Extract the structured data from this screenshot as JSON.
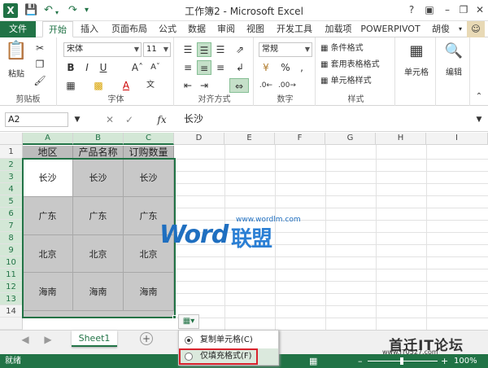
{
  "window": {
    "title": "工作簿2 - Microsoft Excel",
    "help": "?",
    "user": "胡俊",
    "app_icon": "X"
  },
  "ribbon_tabs": [
    "文件",
    "开始",
    "插入",
    "页面布局",
    "公式",
    "数据",
    "审阅",
    "视图",
    "开发工具",
    "加载项",
    "POWERPIVOT"
  ],
  "ribbon": {
    "clipboard": {
      "paste": "粘贴",
      "label": "剪贴板"
    },
    "font": {
      "name": "宋体",
      "size": "11",
      "label": "字体"
    },
    "alignment": {
      "label": "对齐方式"
    },
    "number": {
      "format": "常规",
      "percent": "%",
      "comma": ",",
      "label": "数字"
    },
    "styles": {
      "conditional": "条件格式",
      "table": "套用表格格式",
      "cell": "单元格样式",
      "label": "样式"
    },
    "cells": {
      "label": "单元格"
    },
    "editing": {
      "label": "编辑"
    }
  },
  "formula_bar": {
    "name_box": "A2",
    "fx": "fx",
    "value": "长沙"
  },
  "columns": [
    "A",
    "B",
    "C",
    "D",
    "E",
    "F",
    "G",
    "H",
    "I"
  ],
  "rows": [
    "1",
    "2",
    "3",
    "4",
    "5",
    "6",
    "7",
    "8",
    "9",
    "10",
    "11",
    "12",
    "13",
    "14"
  ],
  "header_row": [
    "地区",
    "产品名称",
    "订购数量"
  ],
  "merged_values": [
    [
      "长沙",
      "长沙",
      "长沙"
    ],
    [
      "广东",
      "广东",
      "广东"
    ],
    [
      "北京",
      "北京",
      "北京"
    ],
    [
      "海南",
      "海南",
      "海南"
    ]
  ],
  "watermark": {
    "word": "Word",
    "lm": "联盟",
    "url": "www.wordlm.com"
  },
  "paste_options": {
    "items": [
      "复制单元格(C)",
      "仅填充格式(F)"
    ],
    "selected": 0
  },
  "sheet": {
    "tab": "Sheet1",
    "add": "+"
  },
  "status": {
    "text": "就绪",
    "zoom": "100%"
  },
  "branding": {
    "name": "首迁IT论坛",
    "url": "www.IT0527.com"
  }
}
